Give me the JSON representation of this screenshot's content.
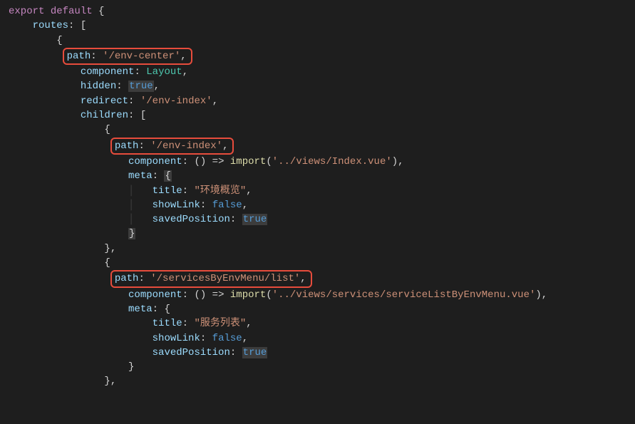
{
  "code": {
    "export": "export",
    "default": "default",
    "routesKey": "routes",
    "route1": {
      "pathKey": "path",
      "pathVal": "'/env-center'",
      "componentKey": "component",
      "componentVal": "Layout",
      "hiddenKey": "hidden",
      "hiddenVal": "true",
      "redirectKey": "redirect",
      "redirectVal": "'/env-index'",
      "childrenKey": "children"
    },
    "child1": {
      "pathKey": "path",
      "pathVal": "'/env-index'",
      "componentKey": "component",
      "componentVal": "() => ",
      "importFn": "import",
      "importArg": "'../views/Index.vue'",
      "metaKey": "meta",
      "titleKey": "title",
      "titleVal": "\"环境概览\"",
      "showLinkKey": "showLink",
      "showLinkVal": "false",
      "savedPositionKey": "savedPosition",
      "savedPositionVal": "true"
    },
    "child2": {
      "pathKey": "path",
      "pathVal": "'/servicesByEnvMenu/list'",
      "componentKey": "component",
      "componentVal": "() => ",
      "importFn": "import",
      "importArg": "'../views/services/serviceListByEnvMenu.vue'",
      "metaKey": "meta",
      "titleKey": "title",
      "titleVal": "\"服务列表\"",
      "showLinkKey": "showLink",
      "showLinkVal": "false",
      "savedPositionKey": "savedPosition",
      "savedPositionVal": "true"
    }
  }
}
